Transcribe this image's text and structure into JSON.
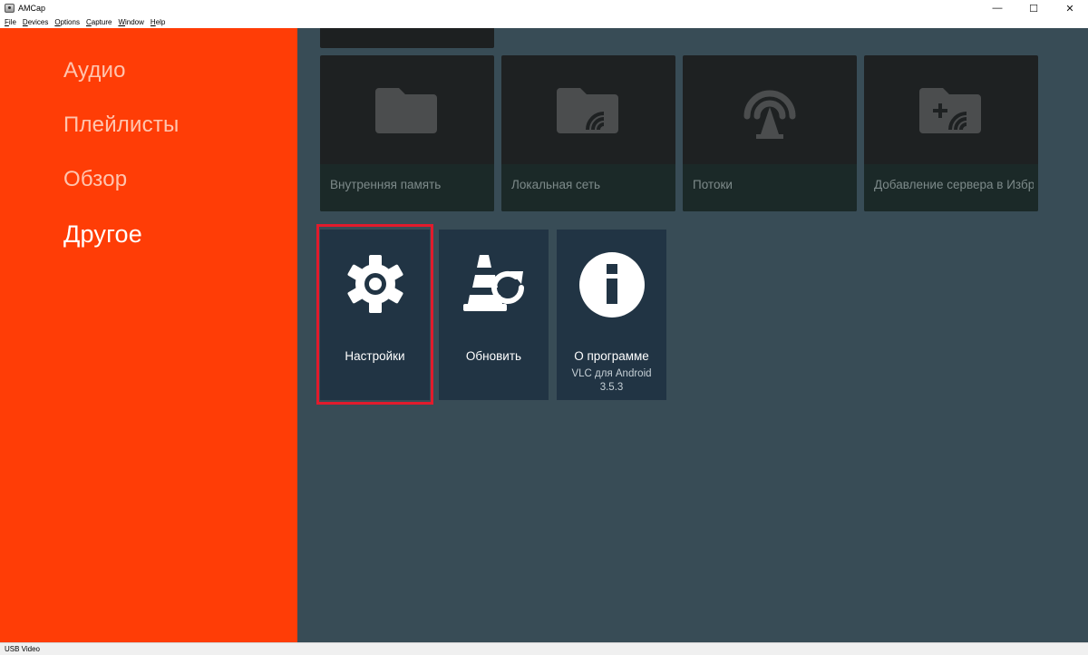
{
  "window": {
    "title": "AMCap",
    "controls": {
      "minimize": "—",
      "maximize": "☐",
      "close": "✕"
    }
  },
  "menubar": [
    {
      "mnemonic": "F",
      "rest": "ile"
    },
    {
      "mnemonic": "D",
      "rest": "evices"
    },
    {
      "mnemonic": "O",
      "rest": "ptions"
    },
    {
      "mnemonic": "C",
      "rest": "apture"
    },
    {
      "mnemonic": "W",
      "rest": "indow"
    },
    {
      "mnemonic": "H",
      "rest": "elp"
    }
  ],
  "sidebar": {
    "items": [
      {
        "label": "Аудио",
        "active": false
      },
      {
        "label": "Плейлисты",
        "active": false
      },
      {
        "label": "Обзор",
        "active": false
      },
      {
        "label": "Другое",
        "active": true
      }
    ]
  },
  "storage": {
    "cards": [
      {
        "label": "Внутренняя память",
        "icon": "folder-icon"
      },
      {
        "label": "Локальная сеть",
        "icon": "network-folder-icon"
      },
      {
        "label": "Потоки",
        "icon": "stream-antenna-icon"
      },
      {
        "label": "Добавление сервера в Избр..",
        "icon": "add-server-icon"
      }
    ]
  },
  "other": {
    "cards": [
      {
        "title": "Настройки",
        "sub": "",
        "icon": "gear-icon",
        "focused": true
      },
      {
        "title": "Обновить",
        "sub": "",
        "icon": "vlc-refresh-icon"
      },
      {
        "title": "О программе",
        "sub": "VLC для Android",
        "sub2": "3.5.3",
        "icon": "info-icon"
      }
    ]
  },
  "colors": {
    "sidebar": "#ff3d06",
    "background": "#384c56",
    "card": "#213444",
    "focus_ring": "#e21b2c"
  },
  "statusbar": {
    "text": "USB Video"
  }
}
